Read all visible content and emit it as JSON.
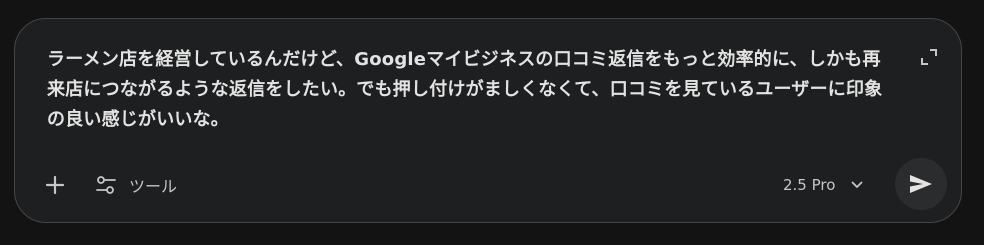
{
  "composer": {
    "prompt_text": "ラーメン店を経営しているんだけど、Googleマイビジネスの口コミ返信をもっと効率的に、しかも再来店につながるような返信をしたい。でも押し付けがましくなくて、口コミを見ているユーザーに印象の良い感じがいいな。",
    "expand_icon": "expand-icon",
    "add_icon": "plus-icon",
    "tools_icon": "tools-sliders-icon",
    "tools_label": "ツール",
    "model_label": "2.5 Pro",
    "model_chevron_icon": "chevron-down-icon",
    "send_icon": "send-icon"
  },
  "colors": {
    "page_background": "#131314",
    "composer_background": "#1e1f20",
    "composer_border": "#444746",
    "primary_text": "#e3e3e3",
    "secondary_text": "#c4c7c5",
    "send_button_background": "#2b2c2e"
  }
}
